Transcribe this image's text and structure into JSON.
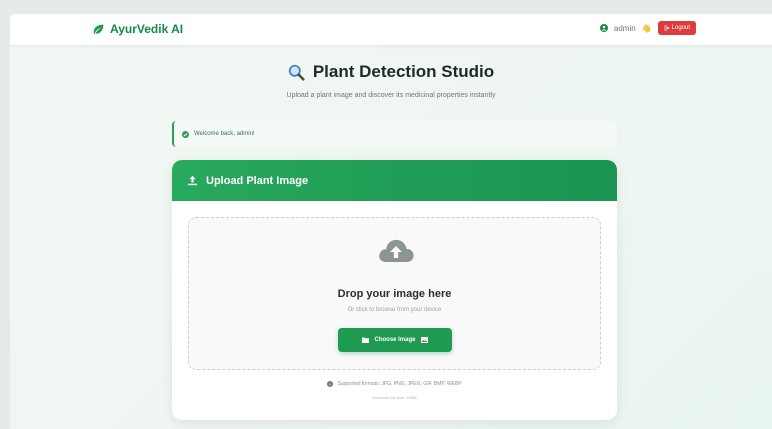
{
  "navbar": {
    "brand": "AyurVedik AI",
    "username": "admin",
    "wave": "👋",
    "logout_label": "Logout"
  },
  "page": {
    "title": "Plant Detection Studio",
    "subtitle": "Upload a plant image and discover its medicinal properties instantly"
  },
  "alert": {
    "message": "Welcome back, admin!"
  },
  "upload_card": {
    "header": "Upload Plant Image",
    "drop_title": "Drop your image here",
    "drop_subtitle": "Or click to browse from your device",
    "choose_button": "Choose Image",
    "supported_formats": "Supported formats: JPG, PNG, JPEG, GIF, BMP, WEBP",
    "max_size": "Maximum file size: 16MB"
  },
  "icons": {
    "brand": "leaf-icon",
    "user": "user-circle-icon",
    "logout": "sign-out-icon",
    "title": "magnifier-icon",
    "alert": "check-circle-icon",
    "header": "upload-icon",
    "dropzone": "cloud-upload-icon",
    "button": "folder-icon",
    "formats": "info-circle-icon"
  },
  "colors": {
    "brand_green": "#17894a",
    "header_green": "#27a95e",
    "button_green": "#1f9a53",
    "logout_red": "#dc3c3c"
  }
}
